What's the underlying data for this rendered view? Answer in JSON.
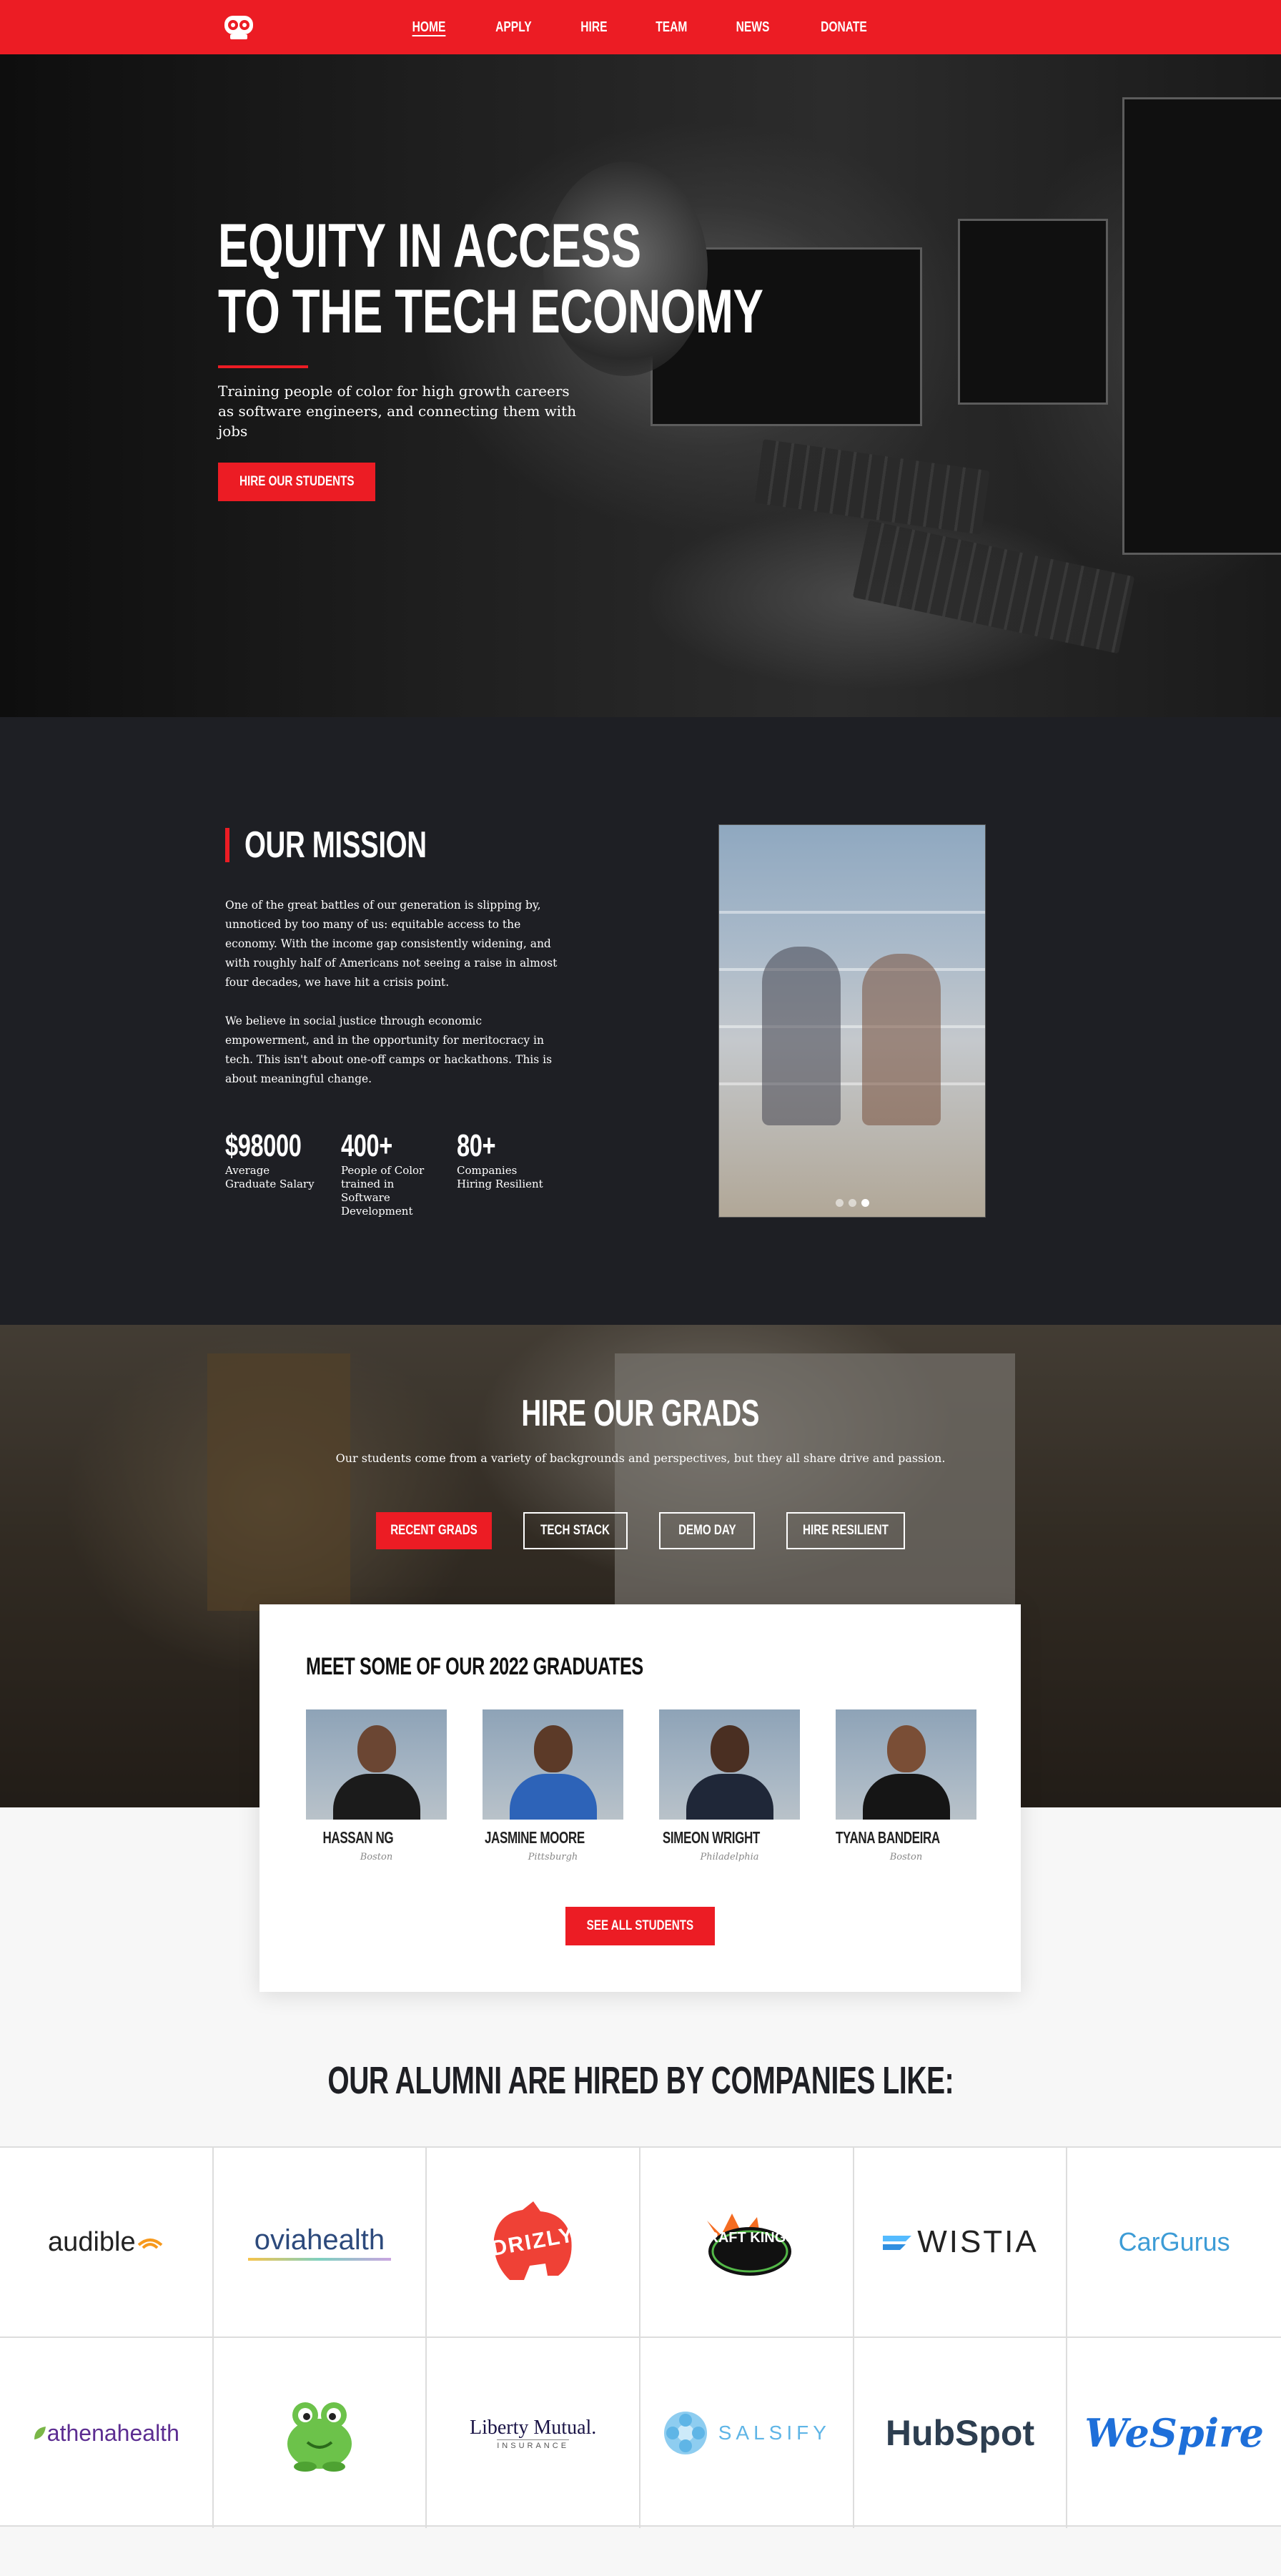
{
  "nav": {
    "links": [
      "HOME",
      "APPLY",
      "HIRE",
      "TEAM",
      "NEWS",
      "DONATE"
    ],
    "active": "HOME",
    "logo_icon": "owl-logo-icon",
    "bar_color": "#ec1c24"
  },
  "hero": {
    "title_line1": "EQUITY IN ACCESS",
    "title_line2": "TO THE TECH ECONOMY",
    "subtitle": "Training people of color for high growth careers as software engineers, and connecting them with jobs",
    "cta": "HIRE OUR STUDENTS"
  },
  "mission": {
    "title": "OUR MISSION",
    "paragraph1": "One of the great battles of our generation is slipping by, unnoticed by too many of us: equitable access to the economy. With the income gap consistently widening, and with roughly half of Americans not seeing a raise in almost four decades, we have hit a crisis point.",
    "paragraph2": "We believe in social justice through economic empowerment, and in the opportunity for meritocracy in tech. This isn't about one-off camps or hackathons. This is about meaningful change.",
    "stats": [
      {
        "value": "$98000",
        "label": "Average Graduate Salary"
      },
      {
        "value": "400+",
        "label": "People of Color trained in Software Development"
      },
      {
        "value": "80+",
        "label": "Companies Hiring Resilient"
      }
    ],
    "carousel": {
      "slides": 3,
      "active_index": 2
    }
  },
  "hire": {
    "title": "HIRE OUR GRADS",
    "subtitle": "Our students come from a variety of backgrounds and perspectives, but they all share drive and passion.",
    "tabs": [
      "RECENT GRADS",
      "TECH STACK",
      "DEMO DAY",
      "HIRE RESILIENT"
    ],
    "active_tab": "RECENT GRADS"
  },
  "graduates": {
    "title": "MEET SOME OF OUR 2022 GRADUATES",
    "people": [
      {
        "name": "HASSAN NG",
        "city": "Boston"
      },
      {
        "name": "JASMINE MOORE",
        "city": "Pittsburgh"
      },
      {
        "name": "SIMEON WRIGHT",
        "city": "Philadelphia"
      },
      {
        "name": "TYANA BANDEIRA",
        "city": "Boston"
      }
    ],
    "cta": "SEE ALL STUDENTS"
  },
  "alumni": {
    "title": "OUR ALUMNI ARE HIRED BY COMPANIES LIKE:",
    "companies": [
      "audible",
      "oviahealth",
      "DRIZLY",
      "DRAFT KINGS",
      "WISTIA",
      "CarGurus",
      "athenahealth",
      "frog",
      "Liberty Mutual.",
      "SALSIFY",
      "HubSpot",
      "WeSpire"
    ],
    "liberty_sub": "INSURANCE"
  }
}
